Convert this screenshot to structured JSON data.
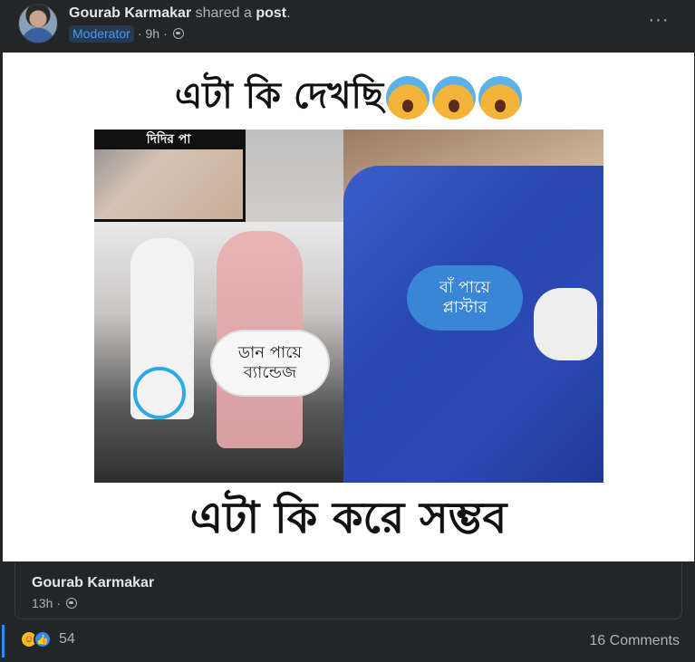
{
  "post_header": {
    "author_name": "Gourab Karmakar",
    "action_text": " shared a ",
    "post_word": "post",
    "period": ".",
    "badge": "Moderator",
    "separator": "·",
    "time": "9h",
    "audience_icon": "globe-icon",
    "more_label": "···"
  },
  "shared_image": {
    "top_caption": "এটা কি দেখছি",
    "bottom_caption": "এটা কি করে সম্ভব",
    "foot_label": "দিদির পা",
    "left_bubble_line1": "ডান পায়ে",
    "left_bubble_line2": "ব্যান্ডেজ",
    "right_bubble_line1": "বাঁ পায়ে",
    "right_bubble_line2": "প্লাস্টার",
    "emoji_icon": "face-screaming-in-fear-icon"
  },
  "shared_post": {
    "author_name": "Gourab Karmakar",
    "time": "13h",
    "separator": "·"
  },
  "footer": {
    "reaction_icons": [
      "haha-icon",
      "like-icon"
    ],
    "reaction_count": "54",
    "comments_label": "16 Comments"
  },
  "colors": {
    "background": "#242526",
    "text_primary": "#e4e6eb",
    "text_secondary": "#b0b3b8",
    "accent": "#2d88ff",
    "badge_text": "#4599ff"
  }
}
